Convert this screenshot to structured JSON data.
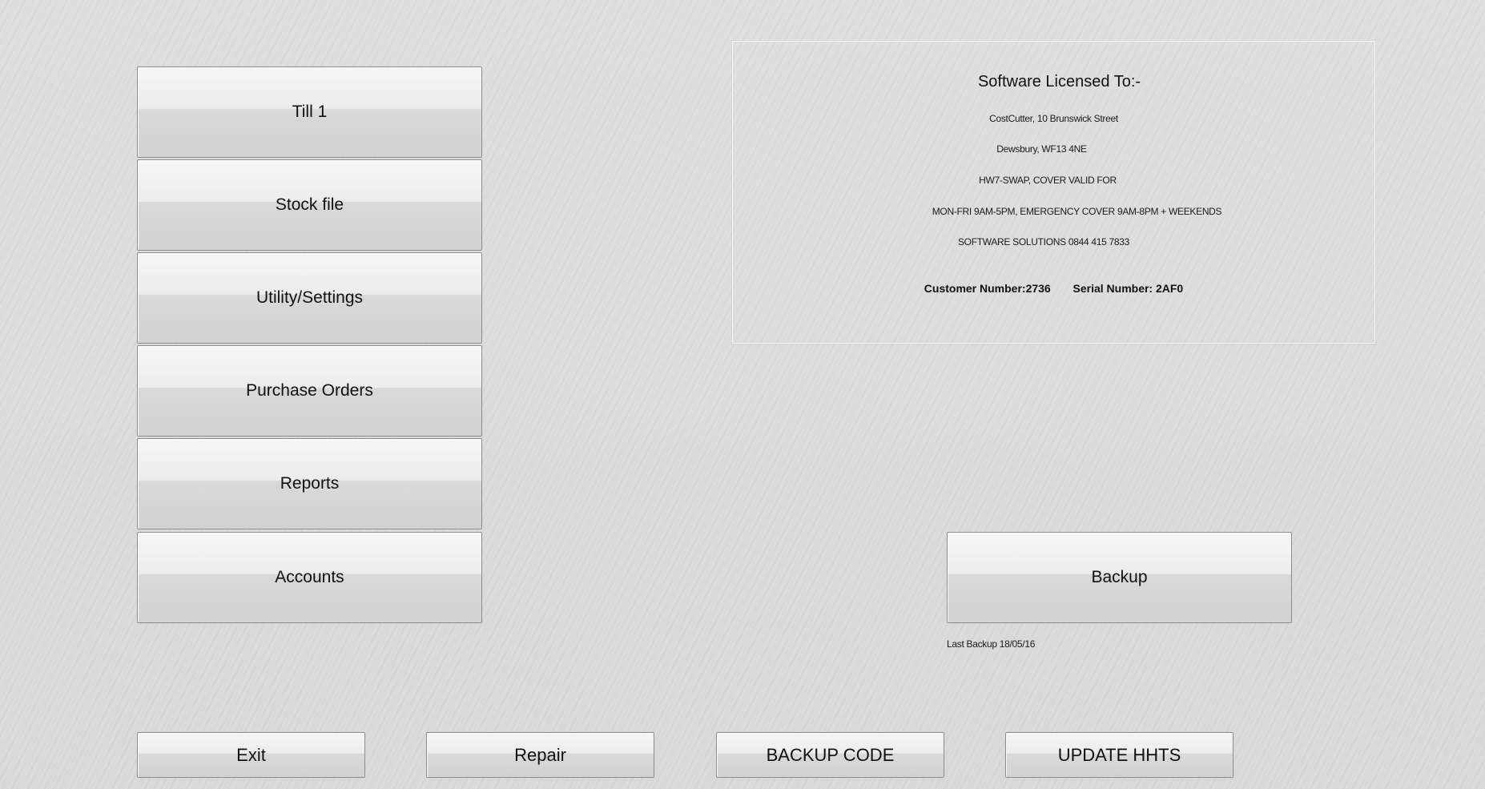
{
  "menu": {
    "till": "Till 1",
    "stock_file": "Stock file",
    "utility_settings": "Utility/Settings",
    "purchase_orders": "Purchase Orders",
    "reports": "Reports",
    "accounts": "Accounts"
  },
  "license": {
    "title": "Software Licensed To:-",
    "line1": "CostCutter, 10 Brunswick Street",
    "line2": "Dewsbury, WF13 4NE",
    "line3": "HW7-SWAP, COVER VALID FOR",
    "line4": "MON-FRI 9AM-5PM, EMERGENCY COVER 9AM-8PM + WEEKENDS",
    "line5": "SOFTWARE SOLUTIONS 0844 415 7833",
    "customer_number": "Customer Number:2736",
    "serial_number": "Serial Number: 2AF0"
  },
  "backup": {
    "button_label": "Backup",
    "last_backup": "Last Backup 18/05/16"
  },
  "bottom_bar": {
    "exit": "Exit",
    "repair": "Repair",
    "backup_code": "BACKUP CODE",
    "update_hhts": "UPDATE HHTS"
  }
}
